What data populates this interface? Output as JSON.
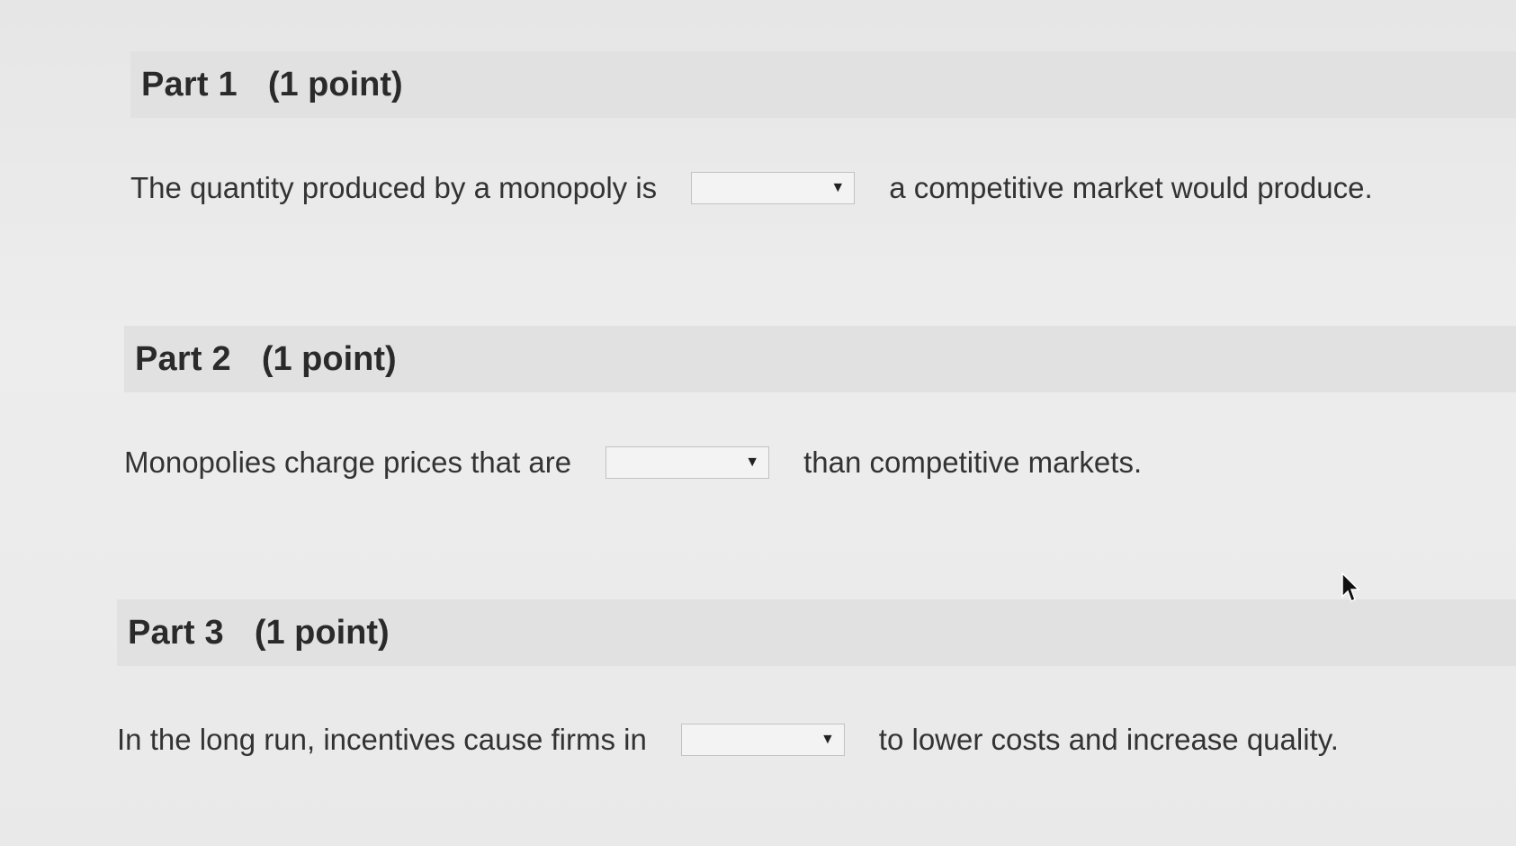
{
  "parts": [
    {
      "title": "Part 1",
      "points": "(1 point)",
      "text_before": "The quantity produced by a monopoly is",
      "selected_value": "",
      "text_after": "a competitive market would produce."
    },
    {
      "title": "Part 2",
      "points": "(1 point)",
      "text_before": "Monopolies charge prices that are",
      "selected_value": "",
      "text_after": "than competitive markets."
    },
    {
      "title": "Part 3",
      "points": "(1 point)",
      "text_before": "In the long run, incentives cause firms in",
      "selected_value": "",
      "text_after": "to lower costs and increase quality."
    }
  ],
  "icons": {
    "dropdown": "chevron-down-icon",
    "cursor": "mouse-pointer-icon"
  },
  "colors": {
    "background": "#ececec",
    "header_band": "#e1e1e1",
    "text": "#2e2e2e"
  }
}
